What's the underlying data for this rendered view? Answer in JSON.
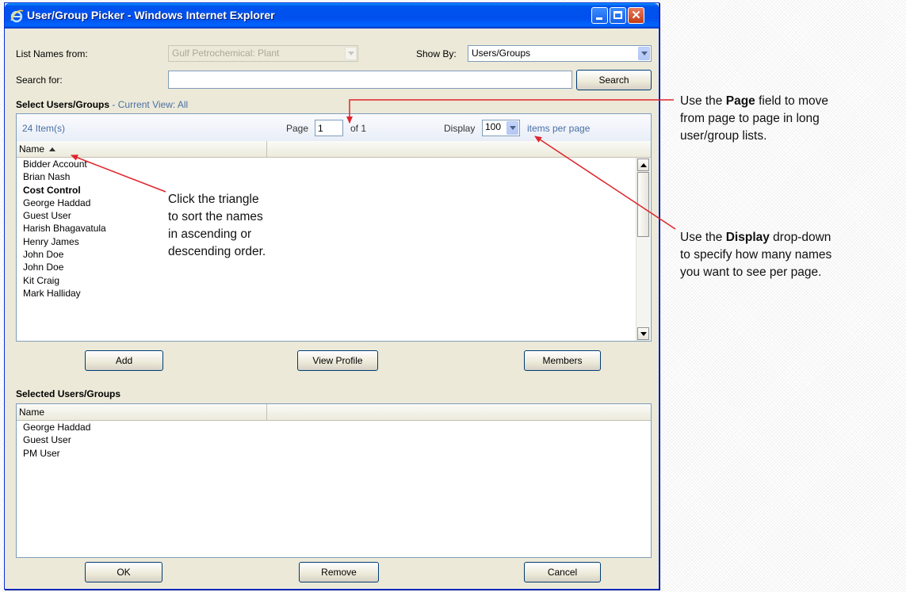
{
  "window": {
    "title": "User/Group Picker - Windows Internet Explorer",
    "icon": "ie-icon"
  },
  "filters": {
    "list_names_label": "List Names from:",
    "list_names_value": "Gulf Petrochemical: Plant",
    "show_by_label": "Show By:",
    "show_by_value": "Users/Groups",
    "search_label": "Search for:",
    "search_value": "",
    "search_button": "Search"
  },
  "select_section": {
    "title": "Select Users/Groups",
    "current_view": "- Current View:  All"
  },
  "pager": {
    "items_count": "24  Item(s)",
    "page_label": "Page",
    "page_value": "1",
    "of_label": "of  1",
    "display_label": "Display",
    "display_value": "100",
    "per_page_label": "items per page"
  },
  "list": {
    "column": "Name",
    "rows": [
      {
        "name": "Bidder Account",
        "bold": false
      },
      {
        "name": "Brian Nash",
        "bold": false
      },
      {
        "name": "Cost Control",
        "bold": true
      },
      {
        "name": "George Haddad",
        "bold": false
      },
      {
        "name": "Guest User",
        "bold": false
      },
      {
        "name": "Harish Bhagavatula",
        "bold": false
      },
      {
        "name": "Henry James",
        "bold": false
      },
      {
        "name": "John Doe",
        "bold": false
      },
      {
        "name": "John Doe",
        "bold": false
      },
      {
        "name": "Kit Craig",
        "bold": false
      },
      {
        "name": "Mark Halliday",
        "bold": false
      }
    ]
  },
  "list_buttons": {
    "add": "Add",
    "view_profile": "View Profile",
    "members": "Members"
  },
  "selected_section": {
    "title": "Selected Users/Groups",
    "column": "Name",
    "rows": [
      "George Haddad",
      "Guest User",
      "PM User"
    ]
  },
  "bottom_buttons": {
    "ok": "OK",
    "remove": "Remove",
    "cancel": "Cancel"
  },
  "annotations": {
    "triangle": {
      "lines": [
        "Click the triangle",
        "to sort the names",
        "in ascending or",
        "descending order."
      ]
    },
    "page": {
      "pre": "Use the ",
      "bold": "Page",
      "post": " field to move",
      "line2": "from page to page in long",
      "line3": "user/group lists."
    },
    "display": {
      "pre": "Use the ",
      "bold": "Display",
      "post": " drop-down",
      "line2": "to specify how many names",
      "line3": "you want to see per page."
    }
  },
  "colors": {
    "arrow": "#e0242b",
    "titlebar": "#0053ee",
    "panel_border": "#7f9db9"
  }
}
